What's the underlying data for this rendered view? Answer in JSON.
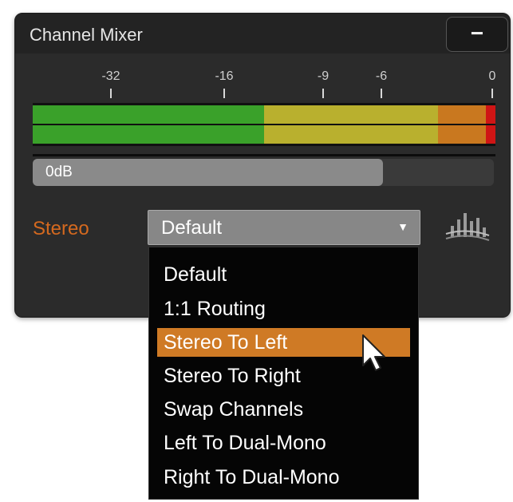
{
  "panel": {
    "title": "Channel Mixer",
    "collapse_label": "−"
  },
  "meter": {
    "scale_labels": [
      "-32",
      "-16",
      "-9",
      "-6",
      "0"
    ],
    "colors": {
      "green": "#3aa12a",
      "yellow": "#b9b02e",
      "orange": "#c9781f",
      "red": "#cf1515"
    }
  },
  "gain": {
    "label": "0dB",
    "level": 0.76
  },
  "stereo": {
    "label": "Stereo",
    "selected": "Default",
    "arrow": "▼",
    "accent": "#d4691f"
  },
  "menu": {
    "items": [
      "Default",
      "1:1 Routing",
      "Stereo To Left",
      "Stereo To Right",
      "Swap Channels",
      "Left To Dual-Mono",
      "Right To Dual-Mono"
    ],
    "highlighted": "Stereo To Left",
    "highlight_color": "#cf7a25"
  },
  "icons": [
    "collapse-icon",
    "dropdown-arrow-icon",
    "equalizer-icon",
    "mouse-cursor-icon"
  ]
}
